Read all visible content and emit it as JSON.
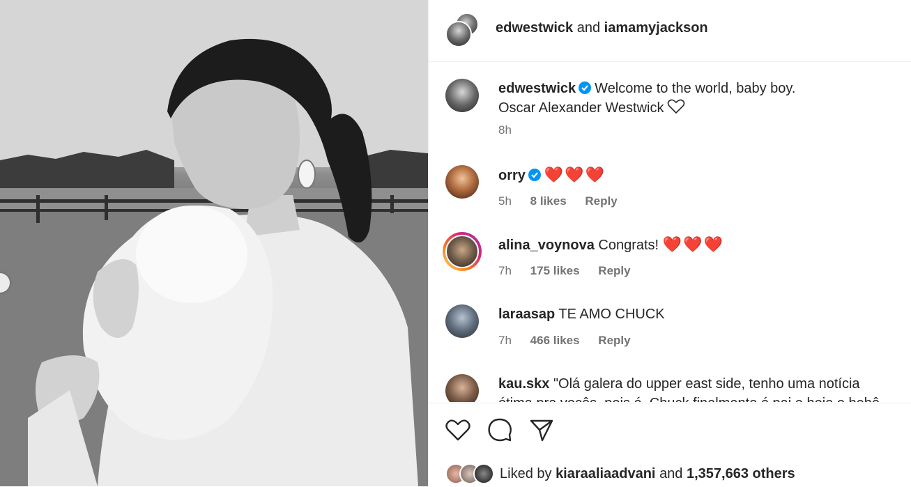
{
  "header": {
    "user1": "edwestwick",
    "conj": "and",
    "user2": "iamamyjackson"
  },
  "caption": {
    "user": "edwestwick",
    "line1": "Welcome to the world, baby boy.",
    "line2": "Oscar Alexander Westwick",
    "time": "8h"
  },
  "comments": [
    {
      "user": "orry",
      "verified": true,
      "text": "❤️❤️❤️",
      "time": "5h",
      "likes": "8 likes",
      "reply": "Reply"
    },
    {
      "user": "alina_voynova",
      "verified": false,
      "text": "Congrats! ",
      "emoji": "❤️❤️❤️",
      "time": "7h",
      "likes": "175 likes",
      "reply": "Reply"
    },
    {
      "user": "laraasap",
      "verified": false,
      "text": "TE AMO CHUCK",
      "time": "7h",
      "likes": "466 likes",
      "reply": "Reply"
    },
    {
      "user": "kau.skx",
      "verified": false,
      "text": "\"Olá galera do upper east side, tenho uma notícia ótima pra vocês, pois é, Chuck finalmente é pai e hoje o bebê"
    }
  ],
  "likes_bar": {
    "prefix": "Liked by",
    "user": "kiaraaliaadvani",
    "and": "and",
    "count": "1,357,663 others"
  },
  "icons": [
    "heart-icon",
    "comment-icon",
    "share-icon",
    "verified-icon",
    "prev-arrow-icon"
  ],
  "colors": {
    "verified": "#0095f6",
    "heart": "#e11f1f",
    "meta": "#737373",
    "story_ring_start": "#feda75",
    "story_ring_end": "#d62976"
  }
}
